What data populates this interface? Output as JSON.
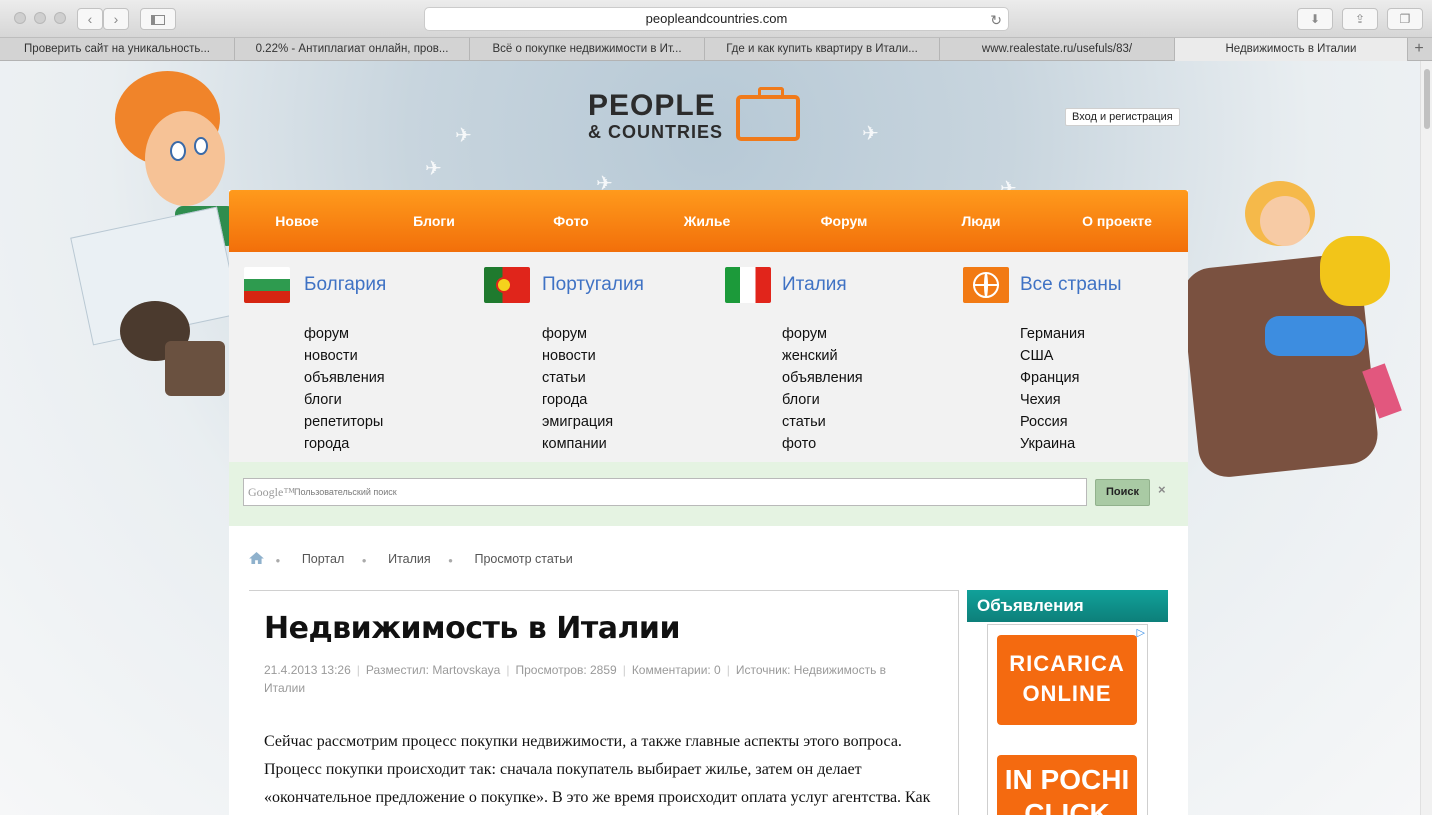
{
  "browser": {
    "url": "peopleandcountries.com",
    "tabs": [
      {
        "label": "Проверить сайт на уникальность..."
      },
      {
        "label": "0.22% - Антиплагиат онлайн, пров..."
      },
      {
        "label": "Всё о покупке недвижимости в Ит..."
      },
      {
        "label": "Где и как купить квартиру в Итали..."
      },
      {
        "label": "www.realestate.ru/usefuls/83/"
      },
      {
        "label": "Недвижимость в Италии"
      }
    ],
    "new_tab": "+"
  },
  "header": {
    "logo_top": "PEOPLE",
    "logo_bottom": "& COUNTRIES",
    "login": "Вход и регистрация"
  },
  "menu": [
    "Новое",
    "Блоги",
    "Фото",
    "Жилье",
    "Форум",
    "Люди",
    "О проекте"
  ],
  "countries": [
    {
      "name": "Болгария",
      "flag": "bulgaria-flag",
      "links": [
        "форум",
        "новости",
        "объявления",
        "блоги",
        "репетиторы",
        "города"
      ]
    },
    {
      "name": "Португалия",
      "flag": "portugal-flag",
      "links": [
        "форум",
        "новости",
        "статьи",
        "города",
        "эмиграция",
        "компании"
      ]
    },
    {
      "name": "Италия",
      "flag": "italy-flag",
      "links": [
        "форум",
        "женский",
        "объявления",
        "блоги",
        "статьи",
        "фото"
      ]
    },
    {
      "name": "Все страны",
      "flag": "globe-icon",
      "links": [
        "Германия",
        "США",
        "Франция",
        "Чехия",
        "Россия",
        "Украина"
      ]
    }
  ],
  "search": {
    "google": "Google™",
    "placeholder": "Пользовательский поиск",
    "button": "Поиск",
    "clear": "×"
  },
  "breadcrumb": [
    "Портал",
    "Италия",
    "Просмотр статьи"
  ],
  "article": {
    "title": "Недвижимость в Италии",
    "date": "21.4.2013 13:26",
    "author": "Разместил: Martovskaya",
    "views": "Просмотров: 2859",
    "comments": "Комментарии: 0",
    "source": "Источник: Недвижимость в Италии",
    "body": "Сейчас рассмотрим процесс покупки недвижимости, а также главные аспекты этого вопроса. Процесс покупки происходит так: сначала покупатель выбирает жилье, затем он делает «окончательное предложение о покупке». В это же время происходит оплата услуг агентства. Как"
  },
  "sidebar": {
    "ads_title": "Объявления",
    "ad1": "RICARICA ONLINE",
    "ad2": "IN POCHI CLICK"
  },
  "colors": {
    "accent": "#f57c12",
    "link": "#3f72c4",
    "ads": "#0f8f89"
  }
}
